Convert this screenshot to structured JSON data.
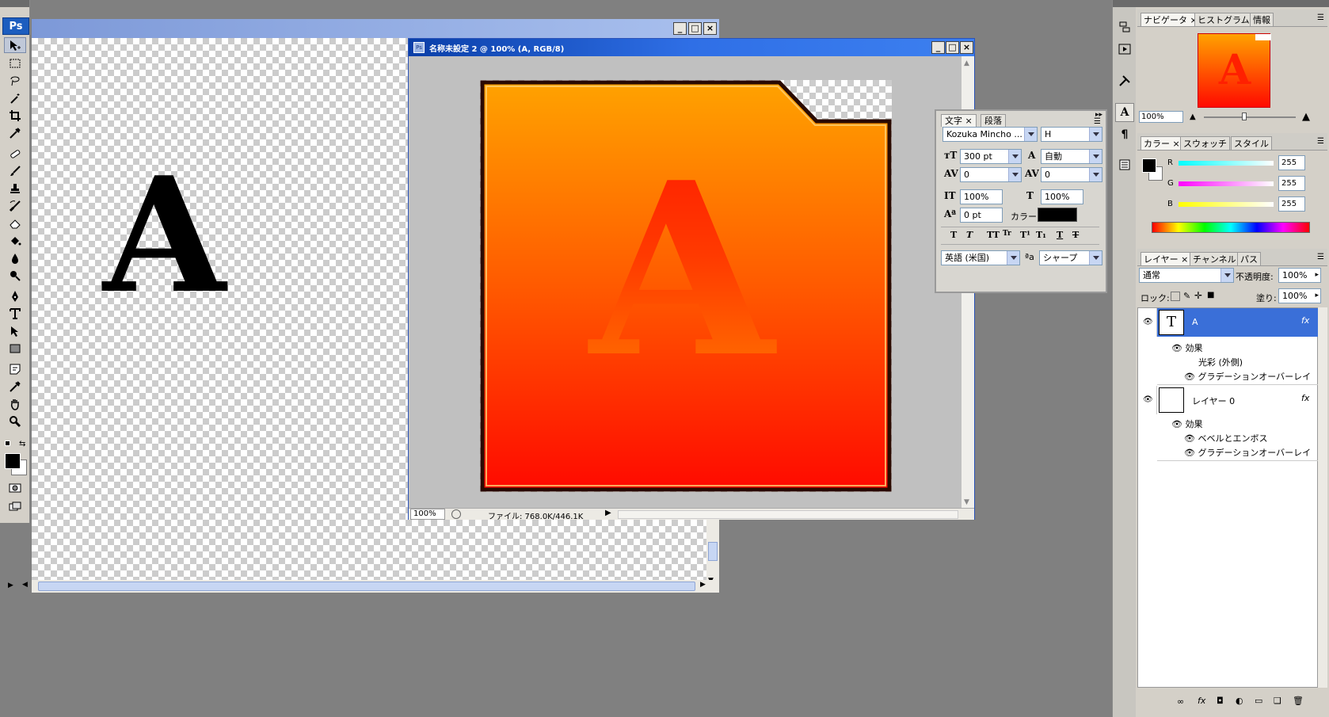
{
  "toolbox": {
    "logo": "Ps",
    "tools": [
      "move-tool-icon",
      "marquee-tool-icon",
      "lasso-tool-icon",
      "magic-wand-icon",
      "crop-tool-icon",
      "eyedropper-tool-icon",
      "healing-brush-icon",
      "brush-tool-icon",
      "clone-stamp-icon",
      "history-brush-icon",
      "eraser-tool-icon",
      "paint-bucket-icon",
      "blur-tool-icon",
      "dodge-tool-icon",
      "pen-tool-icon",
      "type-tool-icon",
      "path-selection-icon",
      "shape-tool-icon",
      "notes-tool-icon",
      "eyedropper2-icon",
      "hand-tool-icon",
      "zoom-tool-icon"
    ]
  },
  "document1": {
    "text_glyph": "A"
  },
  "document2": {
    "title": "名称未設定 2 @ 100% (A, RGB/8)",
    "glyph": "A",
    "zoom": "100%",
    "file_info": "ファイル: 768.0K/446.1K"
  },
  "character_panel": {
    "tabs": [
      "文字",
      "段落"
    ],
    "font_family": "Kozuka Mincho ...",
    "font_style": "H",
    "font_size": "300 pt",
    "leading": "自動",
    "kerning": "0",
    "tracking": "0",
    "vertical_scale": "100%",
    "horizontal_scale": "100%",
    "baseline_shift": "0 pt",
    "color_label": "カラー:",
    "color": "#000000",
    "style_buttons": [
      "T",
      "T",
      "TT",
      "Tr",
      "T¹",
      "T₁",
      "T",
      "T"
    ],
    "language": "英語 (米国)",
    "antialias_icon": "ªa",
    "antialias": "シャープ"
  },
  "navigator_panel": {
    "tabs": [
      "ナビゲータ",
      "ヒストグラム",
      "情報"
    ],
    "zoom": "100%",
    "glyph": "A"
  },
  "color_panel": {
    "tabs": [
      "カラー",
      "スウォッチ",
      "スタイル"
    ],
    "channels": [
      {
        "label": "R",
        "value": "255"
      },
      {
        "label": "G",
        "value": "255"
      },
      {
        "label": "B",
        "value": "255"
      }
    ]
  },
  "layers_panel": {
    "tabs": [
      "レイヤー",
      "チャンネル",
      "パス"
    ],
    "blend_mode": "通常",
    "opacity_label": "不透明度:",
    "opacity": "100%",
    "lock_label": "ロック:",
    "fill_label": "塗り:",
    "fill": "100%",
    "layers": [
      {
        "name": "A",
        "thumb": "T",
        "effects_label": "効果",
        "effects": [
          "光彩 (外側)",
          "グラデーションオーバーレイ"
        ]
      },
      {
        "name": "レイヤー 0",
        "thumb": "",
        "effects_label": "効果",
        "effects": [
          "ベベルとエンボス",
          "グラデーションオーバーレイ"
        ]
      }
    ],
    "fx_label": "fx"
  }
}
